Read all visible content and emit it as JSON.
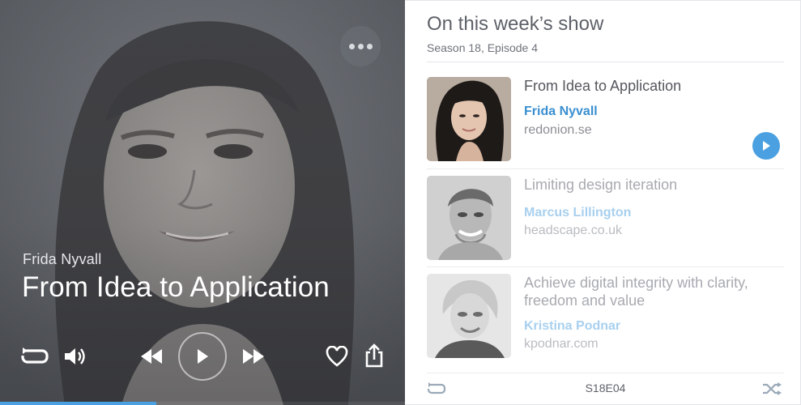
{
  "player": {
    "speaker": "Frida Nyvall",
    "title": "From Idea to Application",
    "progress_fraction": 0.385,
    "icons": {
      "more": "more-horizontal-icon",
      "repeat": "repeat-icon",
      "volume": "volume-icon",
      "rewind": "rewind-icon",
      "play": "play-icon",
      "forward": "fast-forward-icon",
      "like": "heart-icon",
      "share": "share-icon"
    }
  },
  "playlist": {
    "heading": "On this week’s show",
    "subheading": "Season 18, Episode 4",
    "episodes": [
      {
        "title": "From Idea to Application",
        "speaker": "Frida Nyvall",
        "site": "redonion.se",
        "active": true
      },
      {
        "title": "Limiting design iteration",
        "speaker": "Marcus Lillington",
        "site": "headscape.co.uk",
        "active": false
      },
      {
        "title": "Achieve digital integrity with clarity, freedom and value",
        "speaker": "Kristina Podnar",
        "site": "kpodnar.com",
        "active": false
      }
    ],
    "footer": {
      "code": "S18E04"
    }
  },
  "colors": {
    "accent": "#4aa0e0",
    "accent_light": "#a8d0ee",
    "text_dark": "#54575d"
  }
}
